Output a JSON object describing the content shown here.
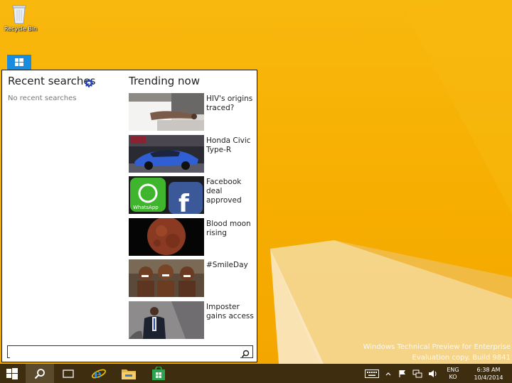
{
  "desktop": {
    "recycle_bin_label": "Recycle Bin",
    "watermark_line1": "Windows Technical Preview for Enterprise",
    "watermark_line2": "Evaluation copy. Build 9841"
  },
  "search_panel": {
    "recent_title": "Recent searches",
    "recent_empty": "No recent searches",
    "trending_title": "Trending now",
    "trending": [
      {
        "label": "HIV's origins traced?",
        "image": "hospital-patient-photo"
      },
      {
        "label": "Honda Civic Type-R",
        "image": "blue-car-photo"
      },
      {
        "label": "Facebook deal approved",
        "image": "whatsapp-facebook-icons-photo"
      },
      {
        "label": "Blood moon rising",
        "image": "red-moon-photo"
      },
      {
        "label": "#SmileDay",
        "image": "smiling-children-photo"
      },
      {
        "label": "Imposter gains access",
        "image": "man-at-podium-photo"
      }
    ],
    "search_value": "",
    "search_placeholder": ""
  },
  "taskbar": {
    "language_line1": "ENG",
    "language_line2": "KO",
    "time": "6:38 AM",
    "date": "10/4/2014"
  },
  "colors": {
    "desktop": "#f6ae00",
    "taskbar": "#3f2d10",
    "accent": "#1a8ce0"
  }
}
